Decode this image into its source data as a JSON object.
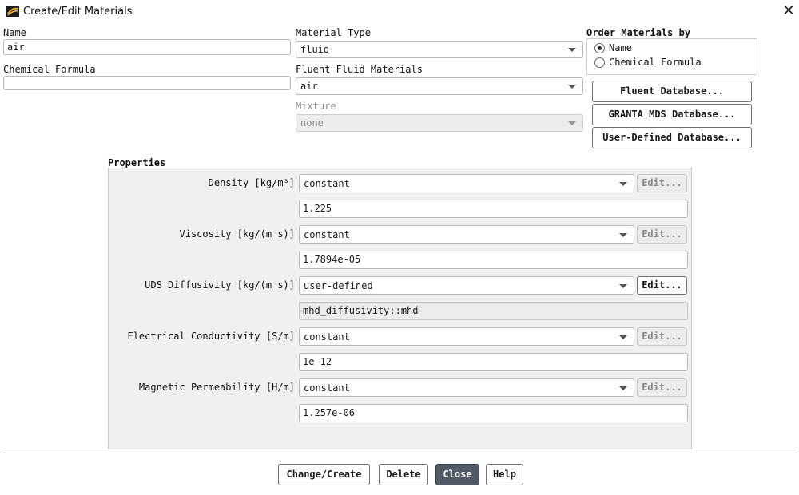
{
  "window": {
    "title": "Create/Edit Materials",
    "close_glyph": "✕"
  },
  "name": {
    "label": "Name",
    "value": "air"
  },
  "chemical_formula": {
    "label": "Chemical Formula",
    "value": ""
  },
  "material_type": {
    "label": "Material Type",
    "value": "fluid"
  },
  "fluent_fluid_materials": {
    "label": "Fluent Fluid Materials",
    "value": "air"
  },
  "mixture": {
    "label": "Mixture",
    "value": "none",
    "enabled": false
  },
  "order_by": {
    "label": "Order Materials by",
    "options": [
      {
        "label": "Name",
        "selected": true
      },
      {
        "label": "Chemical Formula",
        "selected": false
      }
    ]
  },
  "database_buttons": {
    "fluent": "Fluent Database...",
    "granta": "GRANTA MDS Database...",
    "user_defined": "User-Defined Database..."
  },
  "properties": {
    "label": "Properties",
    "edit_label": "Edit...",
    "rows": [
      {
        "label": "Density [kg/m³]",
        "method": "constant",
        "value": "1.225",
        "edit_enabled": false,
        "value_readonly": false
      },
      {
        "label": "Viscosity [kg/(m s)]",
        "method": "constant",
        "value": "1.7894e-05",
        "edit_enabled": false,
        "value_readonly": false
      },
      {
        "label": "UDS Diffusivity [kg/(m s)]",
        "method": "user-defined",
        "value": "mhd_diffusivity::mhd",
        "edit_enabled": true,
        "value_readonly": true
      },
      {
        "label": "Electrical Conductivity [S/m]",
        "method": "constant",
        "value": "1e-12",
        "edit_enabled": false,
        "value_readonly": false
      },
      {
        "label": "Magnetic Permeability [H/m]",
        "method": "constant",
        "value": "1.257e-06",
        "edit_enabled": false,
        "value_readonly": false
      }
    ]
  },
  "footer": {
    "change_create": "Change/Create",
    "delete": "Delete",
    "close": "Close",
    "help": "Help"
  },
  "colors": {
    "primary_button": "#505a66",
    "panel_background": "#f0f0f0",
    "disabled_text": "#8a8a8a"
  },
  "icons": {
    "app": "fluent-app-icon",
    "dropdown": "chevron-down-icon",
    "close": "close-icon"
  }
}
